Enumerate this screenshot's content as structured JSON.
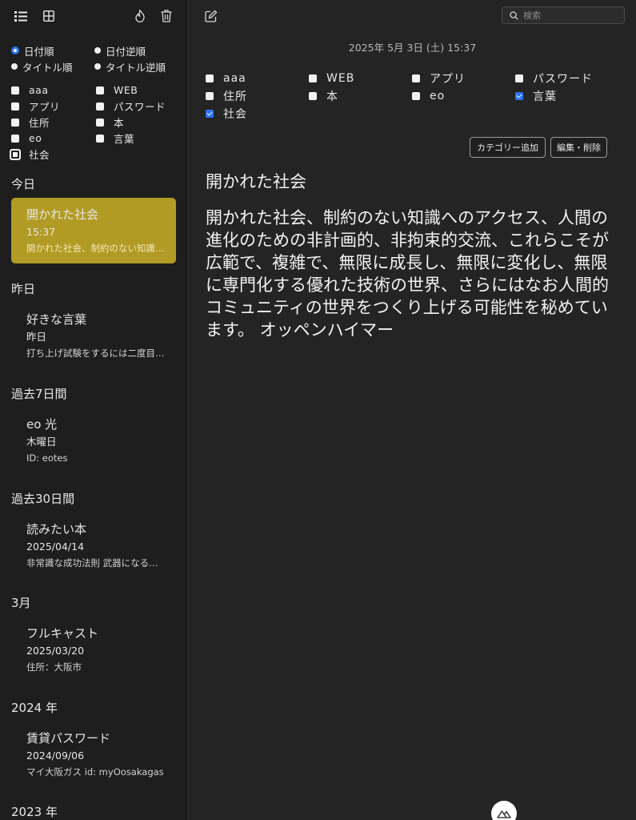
{
  "sidebar": {
    "sort_options": [
      {
        "label": "日付順",
        "selected": true
      },
      {
        "label": "日付逆順",
        "selected": false
      },
      {
        "label": "タイトル順",
        "selected": false
      },
      {
        "label": "タイトル逆順",
        "selected": false
      }
    ],
    "categories": [
      {
        "label": "aaa"
      },
      {
        "label": "WEB"
      },
      {
        "label": "アプリ"
      },
      {
        "label": "パスワード"
      },
      {
        "label": "住所"
      },
      {
        "label": "本"
      },
      {
        "label": "eo"
      },
      {
        "label": "言葉"
      },
      {
        "label": "社会"
      }
    ],
    "groups": [
      {
        "title": "今日",
        "notes": [
          {
            "title": "開かれた社会",
            "date": "15:37",
            "preview": "開かれた社会、制約のない知識へのアクセス、",
            "selected": true
          }
        ]
      },
      {
        "title": "昨日",
        "notes": [
          {
            "title": "好きな言葉",
            "date": "昨日",
            "preview": "打ち上げ試験をするには二度目の打ち上げ",
            "selected": false
          }
        ]
      },
      {
        "title": "過去7日間",
        "notes": [
          {
            "title": "eo 光",
            "date": "木曜日",
            "preview": "ID: eotes",
            "selected": false
          }
        ]
      },
      {
        "title": "過去30日間",
        "notes": [
          {
            "title": "読みたい本",
            "date": "2025/04/14",
            "preview": "非常識な成功法則 武器になる哲学",
            "selected": false
          }
        ]
      },
      {
        "title": "3月",
        "notes": [
          {
            "title": "フルキャスト",
            "date": "2025/03/20",
            "preview": "住所：大阪市",
            "selected": false
          }
        ]
      },
      {
        "title": "2024 年",
        "notes": [
          {
            "title": "賃貸パスワード",
            "date": "2024/09/06",
            "preview": "マイ大阪ガス id: myOosakagas",
            "selected": false
          }
        ]
      },
      {
        "title": "2023 年",
        "notes": []
      }
    ]
  },
  "toolbar": {
    "search_placeholder": "検索",
    "icons": [
      "list-view-icon",
      "grid-view-icon",
      "flame-icon",
      "trash-icon",
      "compose-icon",
      "search-icon"
    ]
  },
  "main": {
    "timestamp": "2025年 5月 3日 (土) 15:37",
    "categories": [
      {
        "label": "aaa",
        "checked": false
      },
      {
        "label": "WEB",
        "checked": false
      },
      {
        "label": "アプリ",
        "checked": false
      },
      {
        "label": "パスワード",
        "checked": false
      },
      {
        "label": "住所",
        "checked": false
      },
      {
        "label": "本",
        "checked": false
      },
      {
        "label": "eo",
        "checked": false
      },
      {
        "label": "言葉",
        "checked": true
      },
      {
        "label": "社会",
        "checked": true
      }
    ],
    "add_category_label": "カテゴリー追加",
    "edit_delete_label": "編集・削除",
    "note_title": "開かれた社会",
    "note_body": "開かれた社会、制約のない知識へのアクセス、人間の進化のための非計画的、非拘束的交流、これらこそが広範で、複雑で、無限に成長し、無限に変化し、無限に専門化する優れた技術の世界、さらにはなお人間的コミュニティの世界をつくり上げる可能性を秘めています。 オッペンハイマー"
  },
  "colors": {
    "background": "#242424",
    "sidebar": "#1e1e1e",
    "selected_note": "#b19b25",
    "accent": "#2a74f5"
  }
}
